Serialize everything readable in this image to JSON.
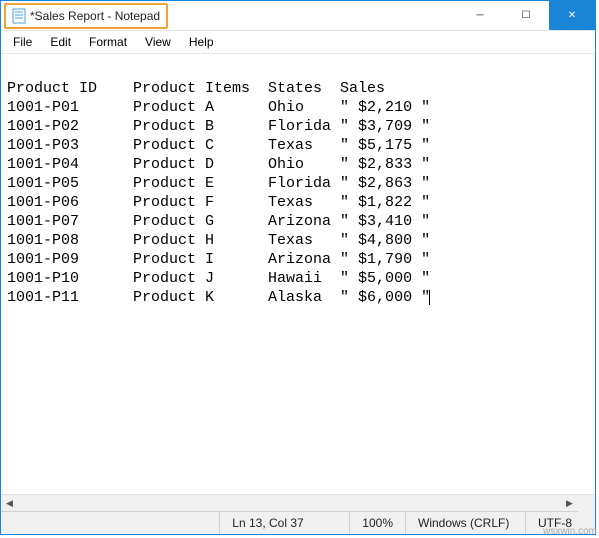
{
  "titlebar": {
    "title": "*Sales Report - Notepad"
  },
  "window_controls": {
    "minimize_glyph": "─",
    "maximize_glyph": "☐",
    "close_glyph": "✕"
  },
  "menu": {
    "items": [
      {
        "label": "File"
      },
      {
        "label": "Edit"
      },
      {
        "label": "Format"
      },
      {
        "label": "View"
      },
      {
        "label": "Help"
      }
    ]
  },
  "editor": {
    "header": {
      "c0": "Product ID",
      "c1": "Product Items",
      "c2": "States",
      "c3": "Sales"
    },
    "rows": [
      {
        "c0": "1001-P01",
        "c1": "Product A",
        "c2": "Ohio",
        "c3": "\" $2,210 \""
      },
      {
        "c0": "1001-P02",
        "c1": "Product B",
        "c2": "Florida",
        "c3": "\" $3,709 \""
      },
      {
        "c0": "1001-P03",
        "c1": "Product C",
        "c2": "Texas",
        "c3": "\" $5,175 \""
      },
      {
        "c0": "1001-P04",
        "c1": "Product D",
        "c2": "Ohio",
        "c3": "\" $2,833 \""
      },
      {
        "c0": "1001-P05",
        "c1": "Product E",
        "c2": "Florida",
        "c3": "\" $2,863 \""
      },
      {
        "c0": "1001-P06",
        "c1": "Product F",
        "c2": "Texas",
        "c3": "\" $1,822 \""
      },
      {
        "c0": "1001-P07",
        "c1": "Product G",
        "c2": "Arizona",
        "c3": "\" $3,410 \""
      },
      {
        "c0": "1001-P08",
        "c1": "Product H",
        "c2": "Texas",
        "c3": "\" $4,800 \""
      },
      {
        "c0": "1001-P09",
        "c1": "Product I",
        "c2": "Arizona",
        "c3": "\" $1,790 \""
      },
      {
        "c0": "1001-P10",
        "c1": "Product J",
        "c2": "Hawaii",
        "c3": "\" $5,000 \""
      },
      {
        "c0": "1001-P11",
        "c1": "Product K",
        "c2": "Alaska",
        "c3": "\" $6,000 \""
      }
    ]
  },
  "scroll": {
    "left_glyph": "◀",
    "right_glyph": "▶"
  },
  "statusbar": {
    "position": "Ln 13, Col 37",
    "zoom": "100%",
    "lineending": "Windows (CRLF)",
    "encoding": "UTF-8"
  },
  "watermark": "wsxwin.com"
}
